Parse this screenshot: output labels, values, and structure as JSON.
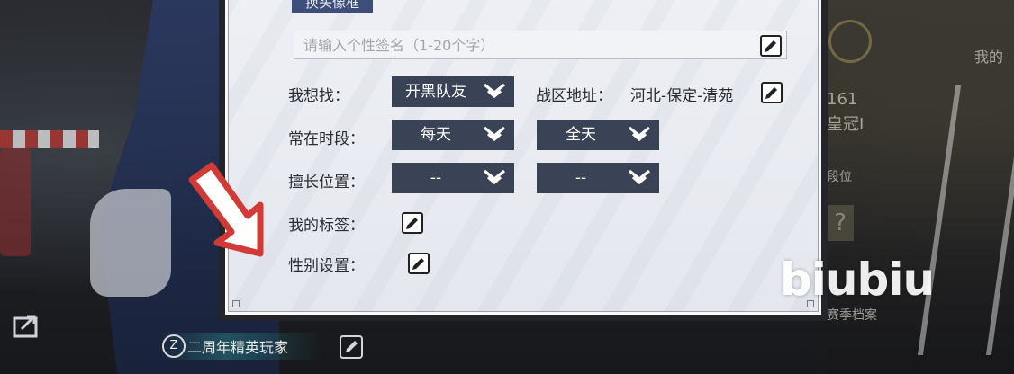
{
  "background": {
    "right_text_1": "我的",
    "right_text_2": "161",
    "right_text_3": "皇冠Ⅰ",
    "right_text_4": "段位",
    "right_text_5": "赛季档案",
    "qmark": "?",
    "watermark": "biubiu"
  },
  "bottom_bar": {
    "badge_label": "二周年精英玩家",
    "badge_glyph": "Z"
  },
  "dialog": {
    "top_button_label": "换头像框",
    "signature": {
      "placeholder": "请输入个性签名（1-20个字）",
      "value": ""
    },
    "looking_for": {
      "label": "我想找：",
      "selected": "开黑队友"
    },
    "zone_address": {
      "label": "战区地址：",
      "value": "河北-保定-清苑"
    },
    "active_period": {
      "label": "常在时段：",
      "day_selected": "每天",
      "time_selected": "全天"
    },
    "good_position": {
      "label": "擅长位置：",
      "primary_selected": "--",
      "secondary_selected": "--"
    },
    "my_tags": {
      "label": "我的标签："
    },
    "gender_setting": {
      "label": "性别设置："
    }
  },
  "colors": {
    "select_bg": "#3a4256",
    "dialog_bg": "#eef0f5",
    "top_button_bg": "#3d4e7b",
    "arrow_red": "#d23a35"
  },
  "icons": {
    "edit": "pencil-edit-icon",
    "dropdown": "double-chevron-down-icon",
    "share": "share-icon"
  }
}
